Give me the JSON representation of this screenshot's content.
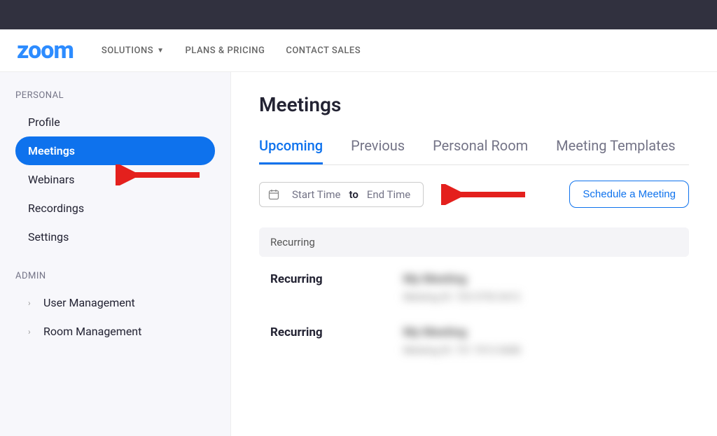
{
  "header": {
    "logo_text": "zoom",
    "nav": [
      {
        "label": "SOLUTIONS",
        "has_caret": true
      },
      {
        "label": "PLANS & PRICING",
        "has_caret": false
      },
      {
        "label": "CONTACT SALES",
        "has_caret": false
      }
    ]
  },
  "sidebar": {
    "sections": [
      {
        "label": "PERSONAL",
        "items": [
          {
            "label": "Profile",
            "active": false,
            "chevron": false
          },
          {
            "label": "Meetings",
            "active": true,
            "chevron": false
          },
          {
            "label": "Webinars",
            "active": false,
            "chevron": false
          },
          {
            "label": "Recordings",
            "active": false,
            "chevron": false
          },
          {
            "label": "Settings",
            "active": false,
            "chevron": false
          }
        ]
      },
      {
        "label": "ADMIN",
        "items": [
          {
            "label": "User Management",
            "active": false,
            "chevron": true
          },
          {
            "label": "Room Management",
            "active": false,
            "chevron": true
          }
        ]
      }
    ]
  },
  "main": {
    "title": "Meetings",
    "tabs": [
      {
        "label": "Upcoming",
        "active": true
      },
      {
        "label": "Previous",
        "active": false
      },
      {
        "label": "Personal Room",
        "active": false
      },
      {
        "label": "Meeting Templates",
        "active": false
      }
    ],
    "date_filter": {
      "start_label": "Start Time",
      "to_label": "to",
      "end_label": "End Time"
    },
    "schedule_button_label": "Schedule a Meeting",
    "group_header": "Recurring",
    "meetings": [
      {
        "label": "Recurring",
        "title_blurred": "My Meeting",
        "sub_blurred": "Meeting ID: 720 5793 0412"
      },
      {
        "label": "Recurring",
        "title_blurred": "My Meeting",
        "sub_blurred": "Meeting ID: 731 7013 0688"
      }
    ]
  }
}
